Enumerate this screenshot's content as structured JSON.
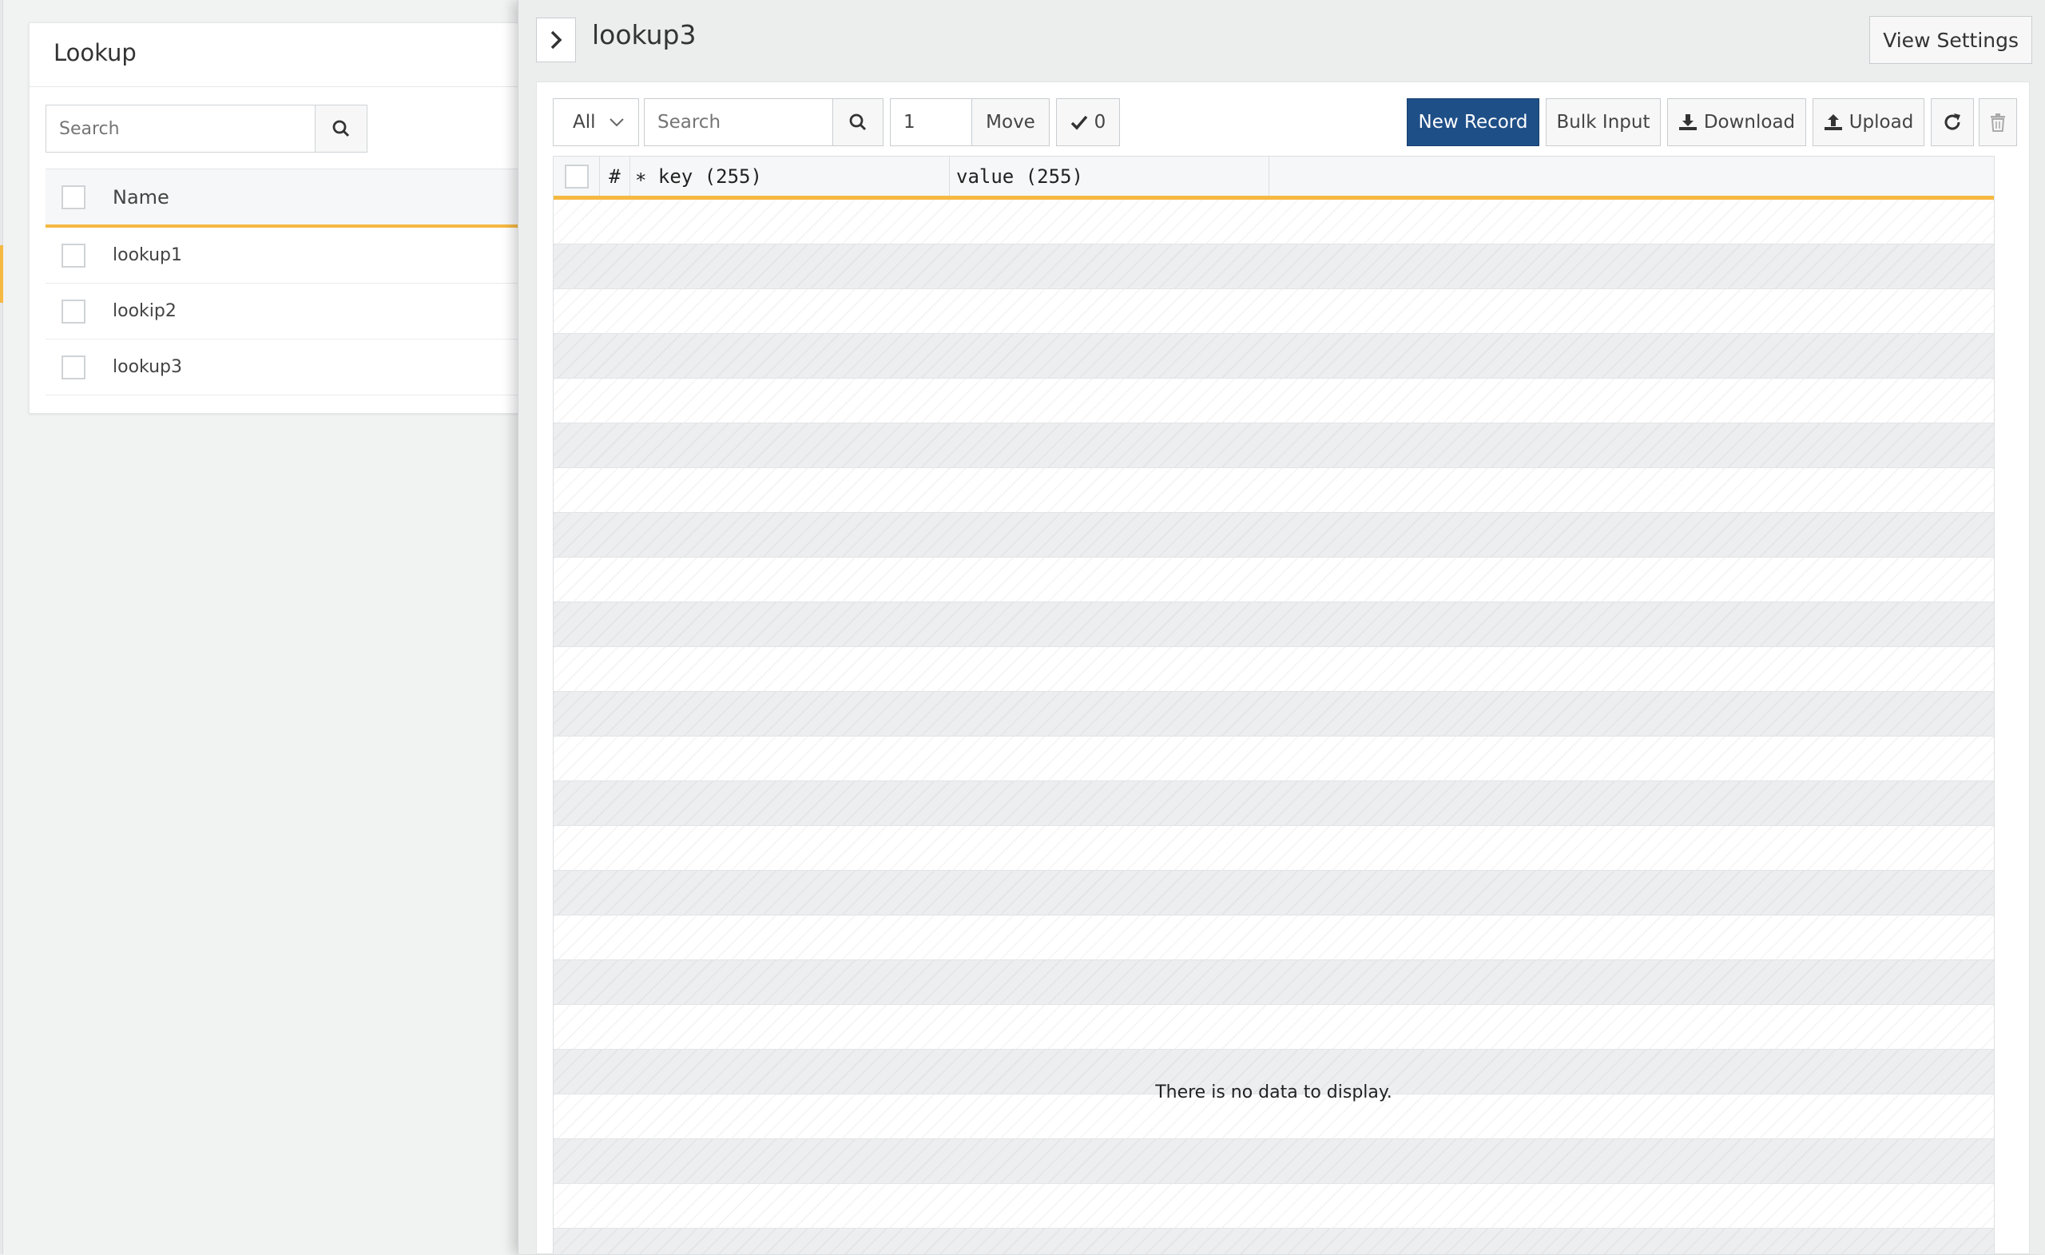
{
  "list_panel": {
    "title": "Lookup",
    "search_placeholder": "Search",
    "header_name": "Name",
    "items": [
      {
        "name": "lookup1"
      },
      {
        "name": "lookip2"
      },
      {
        "name": "lookup3"
      }
    ]
  },
  "drawer": {
    "title": "lookup3",
    "view_settings_label": "View Settings",
    "toolbar": {
      "filter_value": "All",
      "search_placeholder": "Search",
      "page_value": "1",
      "move_label": "Move",
      "checked_count": "0",
      "new_record_label": "New Record",
      "bulk_input_label": "Bulk Input",
      "download_label": "Download",
      "upload_label": "Upload"
    },
    "grid": {
      "col_number": "#",
      "col_key": "∗ key (255)",
      "col_value": "value (255)",
      "empty_message": "There is no data to display."
    }
  },
  "colors": {
    "accent_orange": "#f5b942",
    "primary_blue": "#1f4f87"
  },
  "icons": [
    "search-icon",
    "chevron-right-icon",
    "chevron-down-icon",
    "check-icon",
    "download-icon",
    "upload-icon",
    "refresh-icon",
    "trash-icon"
  ]
}
